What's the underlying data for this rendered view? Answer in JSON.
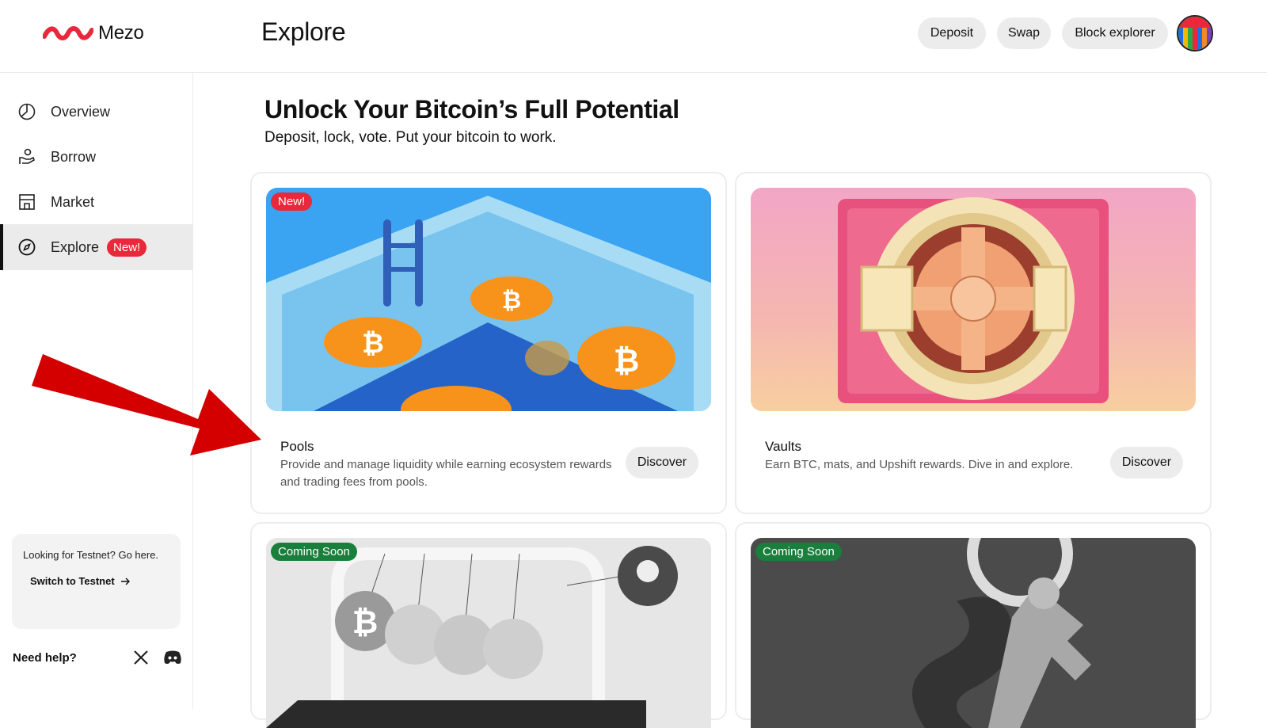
{
  "header": {
    "logo_text": "Mezo",
    "title": "Explore",
    "nav": {
      "deposit": "Deposit",
      "swap": "Swap",
      "block_explorer": "Block explorer"
    },
    "brand_color": "#e9283b"
  },
  "sidebar": {
    "items": [
      {
        "label": "Overview",
        "icon": "overview-icon"
      },
      {
        "label": "Borrow",
        "icon": "borrow-icon"
      },
      {
        "label": "Market",
        "icon": "market-icon"
      },
      {
        "label": "Explore",
        "icon": "compass-icon",
        "badge": "New!",
        "active": true
      }
    ],
    "testnet": {
      "text": "Looking for Testnet? Go here.",
      "link": "Switch to Testnet"
    },
    "help": "Need help?"
  },
  "main": {
    "heading": "Unlock Your Bitcoin’s Full Potential",
    "subheading": "Deposit, lock, vote. Put your bitcoin to work.",
    "cards": [
      {
        "badge": "New!",
        "title": "Pools",
        "description": "Provide and manage liquidity while earning ecosystem rewards and trading fees from pools.",
        "button": "Discover"
      },
      {
        "badge": "",
        "title": "Vaults",
        "description": "Earn BTC, mats, and Upshift rewards. Dive in and explore.",
        "button": "Discover"
      },
      {
        "badge": "Coming Soon",
        "title": "",
        "description": "",
        "button": ""
      },
      {
        "badge": "Coming Soon",
        "title": "",
        "description": "",
        "button": ""
      }
    ]
  },
  "annotation": {
    "arrow_color": "#d40000"
  }
}
